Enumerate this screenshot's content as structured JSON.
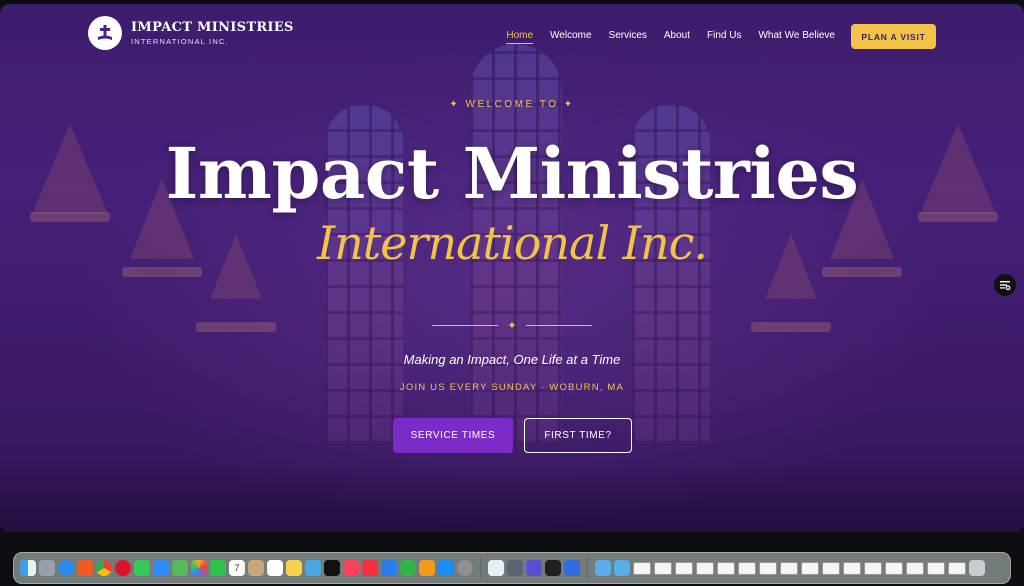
{
  "site": {
    "logo_title": "IMPACT MINISTRIES",
    "logo_subtitle": "INTERNATIONAL INC."
  },
  "nav": {
    "items": [
      {
        "label": "Home",
        "active": true
      },
      {
        "label": "Welcome"
      },
      {
        "label": "Services"
      },
      {
        "label": "About"
      },
      {
        "label": "Find Us"
      },
      {
        "label": "What We Believe"
      }
    ],
    "cta_label": "PLAN A VISIT"
  },
  "hero": {
    "eyebrow": "✦ WELCOME TO ✦",
    "title": "Impact Ministries",
    "script_title": "International Inc.",
    "tagline": "Making an Impact, One Life at a Time",
    "location": "JOIN US EVERY SUNDAY · WOBURN, MA",
    "primary_button": "SERVICE TIMES",
    "secondary_button": "FIRST TIME?"
  },
  "colors": {
    "accent": "#f2c347",
    "primary": "#7b2cc8",
    "background": "#4a2480"
  },
  "dock": {
    "icons": [
      "finder-icon",
      "launchpad-icon",
      "safari-icon",
      "brave-icon",
      "chrome-icon",
      "opera-icon",
      "messages-icon",
      "mail-icon",
      "maps-icon",
      "photos-icon",
      "facetime-icon",
      "calendar-icon",
      "contacts-icon",
      "reminders-icon",
      "notes-icon",
      "freeform-icon",
      "tv-icon",
      "music-icon",
      "news-icon",
      "keynote-icon",
      "numbers-icon",
      "pages-icon",
      "app-store-icon",
      "settings-icon"
    ],
    "calendar_day": "7"
  }
}
